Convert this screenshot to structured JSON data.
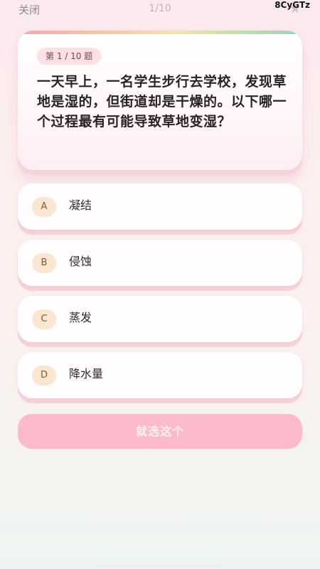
{
  "header": {
    "close_label": "关闭",
    "progress": "1/10",
    "code": "8CyGTz",
    "star_icon": "star-icon"
  },
  "question": {
    "badge": "第 1 / 10 题",
    "text": "一天早上，一名学生步行去学校，发现草地是湿的，但街道却是干燥的。以下哪一个过程最有可能导致草地变湿？"
  },
  "options": [
    {
      "letter": "A",
      "text": "凝结"
    },
    {
      "letter": "B",
      "text": "侵蚀"
    },
    {
      "letter": "C",
      "text": "蒸发"
    },
    {
      "letter": "D",
      "text": "降水量"
    }
  ],
  "confirm_label": "就选这个",
  "colors": {
    "accent": "#fcbacb",
    "letter_bg": "#fde6cf"
  }
}
